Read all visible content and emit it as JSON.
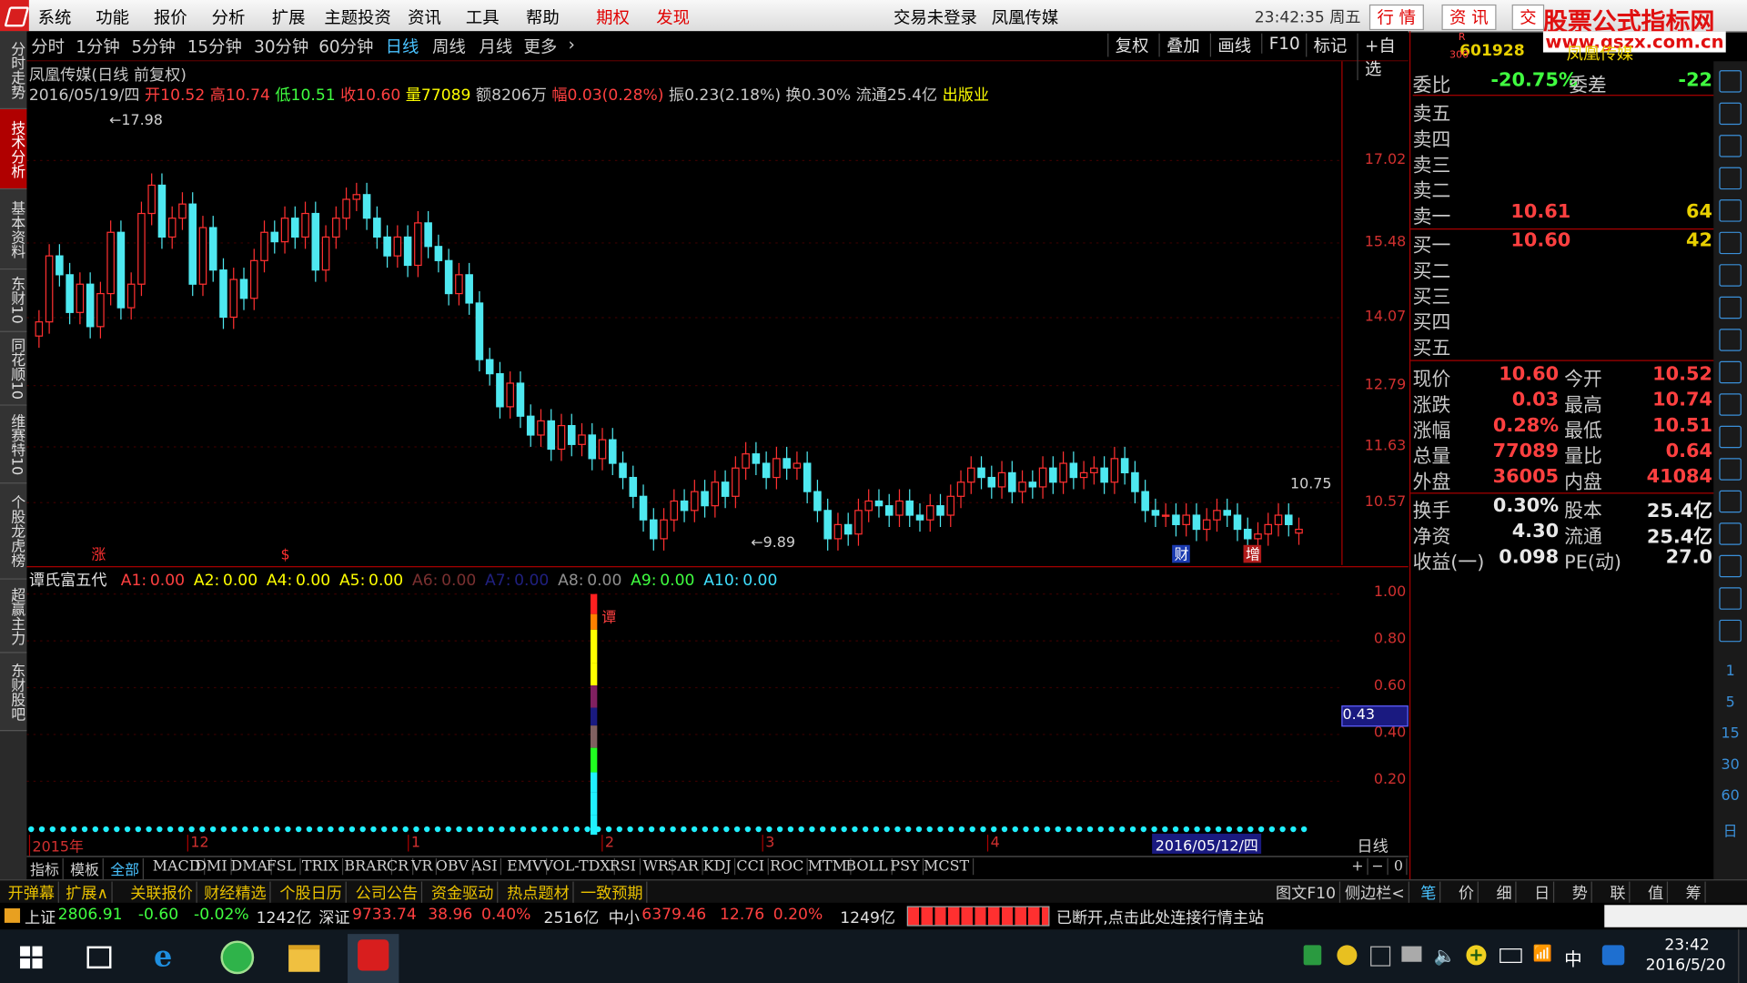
{
  "menu": {
    "items": [
      "系统",
      "功能",
      "报价",
      "分析",
      "扩展",
      "主题投资",
      "资讯",
      "工具",
      "帮助"
    ],
    "hot": [
      "期权",
      "发现"
    ],
    "login": "交易未登录",
    "title": "凤凰传媒",
    "time": "23:42:35 周五",
    "right_tabs": [
      "行 情",
      "资 讯",
      "交"
    ]
  },
  "watermark": {
    "line1": "股票公式指标网",
    "line2": "www.gszx.com.cn"
  },
  "toolbar": {
    "periods": [
      "分时",
      "1分钟",
      "5分钟",
      "15分钟",
      "30分钟",
      "60分钟",
      "日线",
      "周线",
      "月线",
      "更多"
    ],
    "selected": "日线",
    "right": [
      "复权",
      "叠加",
      "画线",
      "F10",
      "标记",
      "+自选"
    ]
  },
  "left_tabs": [
    "分时走势",
    "技术分析",
    "基本资料",
    "东财10",
    "同花顺10",
    "维赛特10",
    "个股龙虎榜",
    "超赢主力",
    "东财股吧"
  ],
  "stock_header": {
    "title": "凤凰传媒(日线 前复权)",
    "date": "2016/05/19/四",
    "open_k": "开",
    "open": "10.52",
    "high_k": "高",
    "high": "10.74",
    "low_k": "低",
    "low": "10.51",
    "close_k": "收",
    "close": "10.60",
    "vol_k": "量",
    "vol": "77089",
    "amt": "额8206万",
    "chg_k": "幅",
    "chg": "0.03(0.28%)",
    "amp": "振0.23(2.18%)",
    "turn": "换0.30%",
    "float": "流通25.4亿",
    "sector": "出版业"
  },
  "price_axis": [
    "17.02",
    "15.48",
    "14.07",
    "12.79",
    "11.63",
    "10.57"
  ],
  "annotations": {
    "max": "17.98",
    "min": "9.89",
    "last": "10.75"
  },
  "markers": [
    "涨",
    "$",
    "财",
    "增"
  ],
  "indicator": {
    "name": "谭氏富五代",
    "lines": [
      {
        "k": "A1:",
        "v": "0.00",
        "c": "#ff4040"
      },
      {
        "k": "A2:",
        "v": "0.00",
        "c": "#ffff00"
      },
      {
        "k": "A4:",
        "v": "0.00",
        "c": "#ffff00"
      },
      {
        "k": "A5:",
        "v": "0.00",
        "c": "#ffff00"
      },
      {
        "k": "A6:",
        "v": "0.00",
        "c": "#7a3030"
      },
      {
        "k": "A7:",
        "v": "0.00",
        "c": "#202080"
      },
      {
        "k": "A8:",
        "v": "0.00",
        "c": "#909090"
      },
      {
        "k": "A9:",
        "v": "0.00",
        "c": "#40ff40"
      },
      {
        "k": "A10:",
        "v": "0.00",
        "c": "#40e0ff"
      }
    ],
    "tag": "谭",
    "axis": [
      "1.00",
      "0.80",
      "0.60",
      "0.40",
      "0.20"
    ],
    "cursor": "0.43"
  },
  "time_axis": {
    "labels": [
      "2015年",
      "12",
      "1",
      "2",
      "3",
      "4"
    ],
    "cursor_date": "2016/05/12/四",
    "period": "日线"
  },
  "right_panel": {
    "code": "601928",
    "code_prefix": "R",
    "code_sub": "300",
    "title": "凤凰传媒",
    "wb_k": "委比",
    "wb": "-20.75%",
    "wc_k": "委差",
    "wc": "-22",
    "sell": [
      {
        "k": "卖五",
        "p": "",
        "v": ""
      },
      {
        "k": "卖四",
        "p": "",
        "v": ""
      },
      {
        "k": "卖三",
        "p": "",
        "v": ""
      },
      {
        "k": "卖二",
        "p": "",
        "v": ""
      },
      {
        "k": "卖一",
        "p": "10.61",
        "v": "64"
      }
    ],
    "buy": [
      {
        "k": "买一",
        "p": "10.60",
        "v": "42"
      },
      {
        "k": "买二",
        "p": "",
        "v": ""
      },
      {
        "k": "买三",
        "p": "",
        "v": ""
      },
      {
        "k": "买四",
        "p": "",
        "v": ""
      },
      {
        "k": "买五",
        "p": "",
        "v": ""
      }
    ],
    "stats": [
      {
        "k1": "现价",
        "v1": "10.60",
        "k2": "今开",
        "v2": "10.52"
      },
      {
        "k1": "涨跌",
        "v1": "0.03",
        "k2": "最高",
        "v2": "10.74"
      },
      {
        "k1": "涨幅",
        "v1": "0.28%",
        "k2": "最低",
        "v2": "10.51"
      },
      {
        "k1": "总量",
        "v1": "77089",
        "k2": "量比",
        "v2": "0.64"
      },
      {
        "k1": "外盘",
        "v1": "36005",
        "k2": "内盘",
        "v2": "41084"
      }
    ],
    "stats2": [
      {
        "k1": "换手",
        "v1": "0.30%",
        "k2": "股本",
        "v2": "25.4亿"
      },
      {
        "k1": "净资",
        "v1": "4.30",
        "k2": "流通",
        "v2": "25.4亿"
      },
      {
        "k1": "收益(一)",
        "v1": "0.098",
        "k2": "PE(动)",
        "v2": "27.0"
      }
    ]
  },
  "bottom_tabs": [
    "指标",
    "模板",
    "全部",
    "MACD",
    "DMI",
    "DMA",
    "FSL",
    "TRIX",
    "BRAR",
    "CR",
    "VR",
    "OBV",
    "ASI",
    "EMV",
    "VOL-TDX",
    "RSI",
    "WR",
    "SAR",
    "KDJ",
    "CCI",
    "ROC",
    "MTM",
    "BOLL",
    "PSY",
    "MCST"
  ],
  "bottom_right": [
    "+",
    "−",
    "0"
  ],
  "bar3": [
    "开弹幕",
    "扩展∧",
    "关联报价",
    "财经精选",
    "个股日历",
    "公司公告",
    "资金驱动",
    "热点题材",
    "一致预期"
  ],
  "bar3_right": [
    "图文F10",
    "侧边栏<"
  ],
  "bar3_tabs": [
    "笔",
    "价",
    "细",
    "日",
    "势",
    "联",
    "值",
    "筹"
  ],
  "status": {
    "sh_k": "上证",
    "sh": "2806.91",
    "sh_c": "-0.60",
    "sh_p": "-0.02%",
    "sh_a": "1242亿",
    "sz_k": "深证",
    "sz": "9733.74",
    "sz_c": "38.96",
    "sz_p": "0.40%",
    "sz_a": "2516亿",
    "zx_k": "中小",
    "zx": "6379.46",
    "zx_c": "12.76",
    "zx_p": "0.20%",
    "zx_a": "1249亿",
    "msg": "已断开,点击此处连接行情主站"
  },
  "right_icons": [
    "1",
    "5",
    "15",
    "30",
    "60",
    "日"
  ],
  "taskbar": {
    "time": "23:42",
    "date": "2016/5/20",
    "ime": "中"
  },
  "chart_data": {
    "type": "candlestick",
    "ohlc_legend": {
      "open": 10.52,
      "high": 10.74,
      "low": 10.51,
      "close": 10.6
    },
    "ylim": [
      9.7,
      18.4
    ],
    "max": 17.98,
    "min": 9.89,
    "closes": [
      15.0,
      16.4,
      16.0,
      15.2,
      15.8,
      14.9,
      15.6,
      16.9,
      15.3,
      15.8,
      17.3,
      17.9,
      16.8,
      17.2,
      17.5,
      15.8,
      17.0,
      16.1,
      15.1,
      15.9,
      15.5,
      16.3,
      16.9,
      16.7,
      17.2,
      16.8,
      17.3,
      16.1,
      16.8,
      17.2,
      17.6,
      17.7,
      17.2,
      16.8,
      16.4,
      16.8,
      16.2,
      17.1,
      16.6,
      16.3,
      15.6,
      16.0,
      15.4,
      14.2,
      13.9,
      13.2,
      13.7,
      13.0,
      12.6,
      12.9,
      12.3,
      12.8,
      12.4,
      12.6,
      12.1,
      12.5,
      12.0,
      11.7,
      11.3,
      10.8,
      10.4,
      10.8,
      11.2,
      11.0,
      11.4,
      11.1,
      11.6,
      11.3,
      11.9,
      12.2,
      12.0,
      11.7,
      12.1,
      11.9,
      12.0,
      11.4,
      11.0,
      10.4,
      10.7,
      10.5,
      11.0,
      11.2,
      11.1,
      10.9,
      11.2,
      10.9,
      10.8,
      11.1,
      10.9,
      11.3,
      11.6,
      11.9,
      11.7,
      11.5,
      11.8,
      11.4,
      11.6,
      11.5,
      11.9,
      11.6,
      12.0,
      11.7,
      11.8,
      11.9,
      11.6,
      12.1,
      11.8,
      11.4,
      11.0,
      10.9,
      10.9,
      10.7,
      10.9,
      10.6,
      10.8,
      11.0,
      10.9,
      10.6,
      10.4,
      10.5,
      10.7,
      10.9,
      10.7,
      10.6
    ]
  }
}
